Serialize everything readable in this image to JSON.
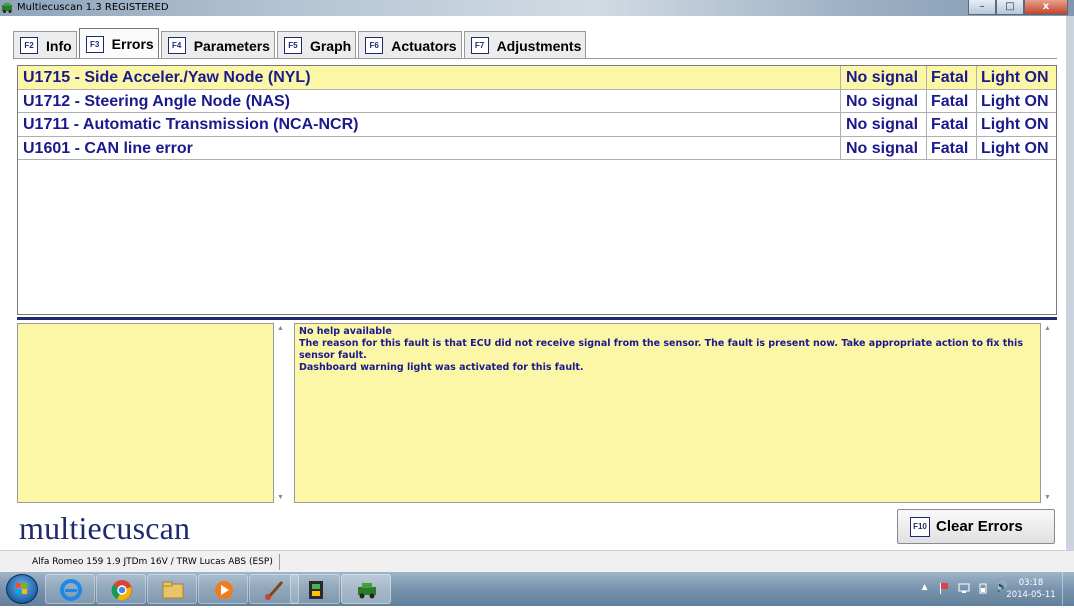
{
  "window": {
    "title": "Multiecuscan 1.3 REGISTERED",
    "minimize": "–",
    "maximize": "□",
    "close": "x"
  },
  "tabs": [
    {
      "key": "F2",
      "label": "Info"
    },
    {
      "key": "F3",
      "label": "Errors"
    },
    {
      "key": "F4",
      "label": "Parameters"
    },
    {
      "key": "F5",
      "label": "Graph"
    },
    {
      "key": "F6",
      "label": "Actuators"
    },
    {
      "key": "F7",
      "label": "Adjustments"
    }
  ],
  "errors": [
    {
      "code": "U1715 - Side Acceler./Yaw Node (NYL)",
      "signal": "No signal",
      "severity": "Fatal",
      "light": "Light ON"
    },
    {
      "code": "U1712 - Steering Angle Node (NAS)",
      "signal": "No signal",
      "severity": "Fatal",
      "light": "Light ON"
    },
    {
      "code": "U1711 - Automatic Transmission (NCA-NCR)",
      "signal": "No signal",
      "severity": "Fatal",
      "light": "Light ON"
    },
    {
      "code": "U1601 - CAN line error",
      "signal": "No signal",
      "severity": "Fatal",
      "light": "Light ON"
    }
  ],
  "help": {
    "line1": "No help available",
    "line2": "The reason for this fault is that ECU did not receive signal from the sensor. The fault is present now. Take appropriate action to fix this sensor fault.",
    "line3": "Dashboard warning light was activated for this fault."
  },
  "logo_text": "multiecuscan",
  "clear_button": {
    "key": "F10",
    "label": "Clear Errors"
  },
  "status": {
    "vehicle": "Alfa Romeo 159 1.9 JTDm 16V / TRW Lucas ABS (ESP)"
  },
  "taskbar": {
    "time": "03:18",
    "date": "2014-05-11",
    "tray_arrow": "▲",
    "volume": "🔊"
  },
  "colors": {
    "accent_navy": "#1e2a6e",
    "highlight_yellow": "#fbf7a6",
    "text_blue": "#1a1a8c"
  }
}
